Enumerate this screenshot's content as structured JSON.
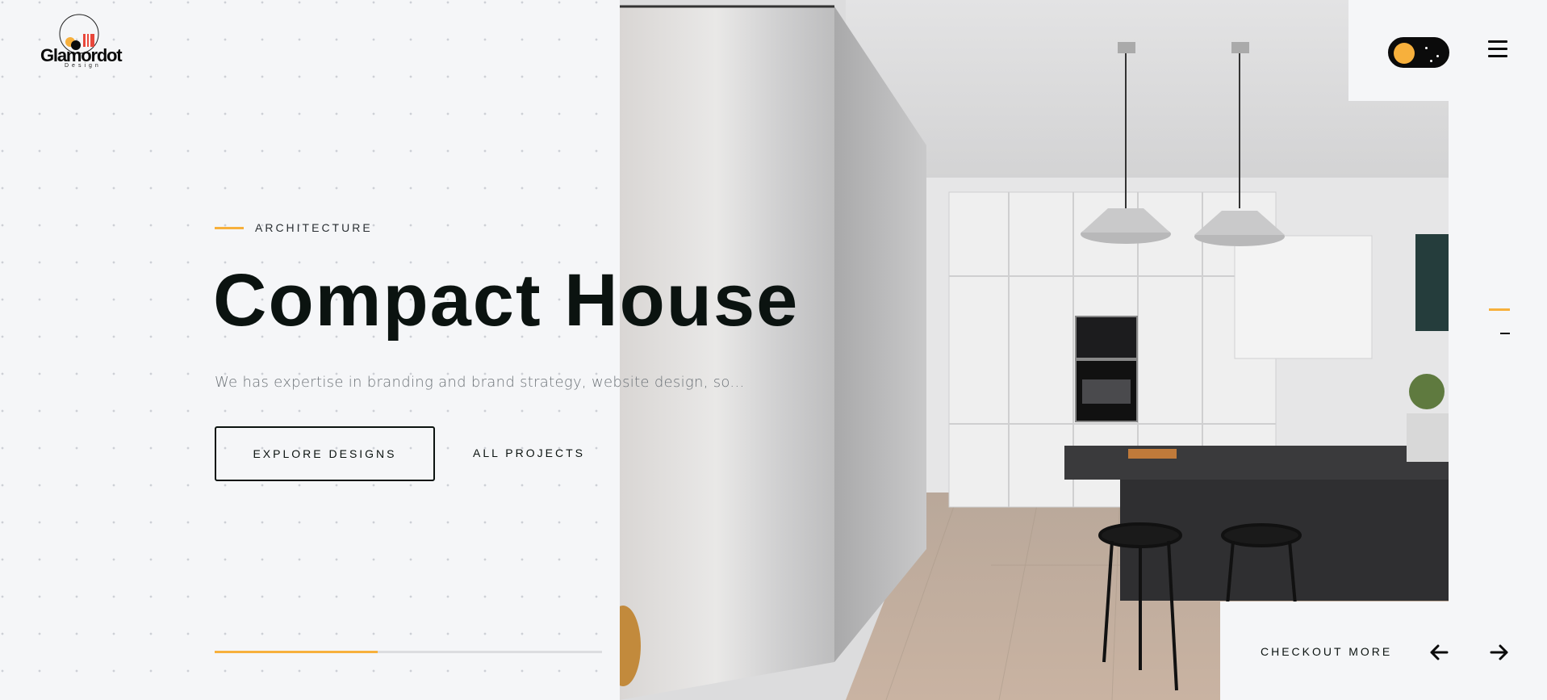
{
  "brand": {
    "name": "Glamordot",
    "tagline": "Design"
  },
  "hero": {
    "kicker": "ARCHITECTURE",
    "title": "Compact House",
    "description": "We has expertise in branding and brand strategy, website design, so...",
    "primary_button": "EXPLORE DESIGNS",
    "secondary_button": "ALL PROJECTS",
    "progress_fraction": 0.42
  },
  "controls": {
    "theme_toggle_icon": "sun-moon-toggle-icon",
    "menu_icon": "hamburger-menu-icon"
  },
  "slider": {
    "checkout_label": "CHECKOUT MORE",
    "prev_icon": "arrow-left-icon",
    "next_icon": "arrow-right-icon"
  },
  "colors": {
    "accent": "#f7b03c",
    "text_dark": "#0b1310",
    "background": "#f5f6f8"
  }
}
